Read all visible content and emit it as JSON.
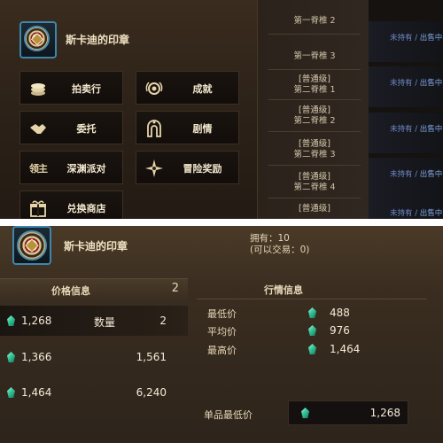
{
  "item": {
    "name": "斯卡迪的印章"
  },
  "menu": [
    {
      "label": "拍卖行",
      "icon": "coin-stack-icon"
    },
    {
      "label": "成就",
      "icon": "laurel-medal-icon"
    },
    {
      "label": "委托",
      "icon": "handshake-icon"
    },
    {
      "label": "剧情",
      "icon": "archway-icon"
    },
    {
      "label": "深渊派对",
      "icon": "lord-emblem-icon"
    },
    {
      "label": "冒险奖励",
      "icon": "compass-star-icon"
    },
    {
      "label": "兑换商店",
      "icon": "gift-box-icon"
    }
  ],
  "menu_icon_glyphs": {
    "lord": "领主"
  },
  "list": [
    {
      "title": "",
      "sub": "第一脊椎 2"
    },
    {
      "title": "",
      "sub": "第一脊椎 3"
    },
    {
      "title": "[普通级]",
      "sub": "第二脊椎 1"
    },
    {
      "title": "[普通级]",
      "sub": "第二脊椎 2"
    },
    {
      "title": "[普通级]",
      "sub": "第二脊椎 3"
    },
    {
      "title": "[普通级]",
      "sub": "第二脊椎 4"
    },
    {
      "title": "[普通级]",
      "sub": ""
    }
  ],
  "status": {
    "not_owned": "未持有",
    "sep": " / ",
    "selling": "出售中"
  },
  "market": {
    "owned": "拥有：10",
    "tradable": "(可以交易：0)",
    "price_info_title": "价格信息",
    "price_info_count": "2",
    "quantity_label": "数量",
    "prices": [
      {
        "price": "1,268",
        "qty": "2"
      },
      {
        "price": "1,366",
        "qty": "1,561"
      },
      {
        "price": "1,464",
        "qty": "6,240"
      }
    ],
    "market_info_title": "行情信息",
    "lowest_label": "最低价",
    "lowest": "488",
    "average_label": "平均价",
    "average": "976",
    "highest_label": "最高价",
    "highest": "1,464",
    "unit_lowest_label": "单品最低价",
    "unit_lowest": "1,268"
  }
}
